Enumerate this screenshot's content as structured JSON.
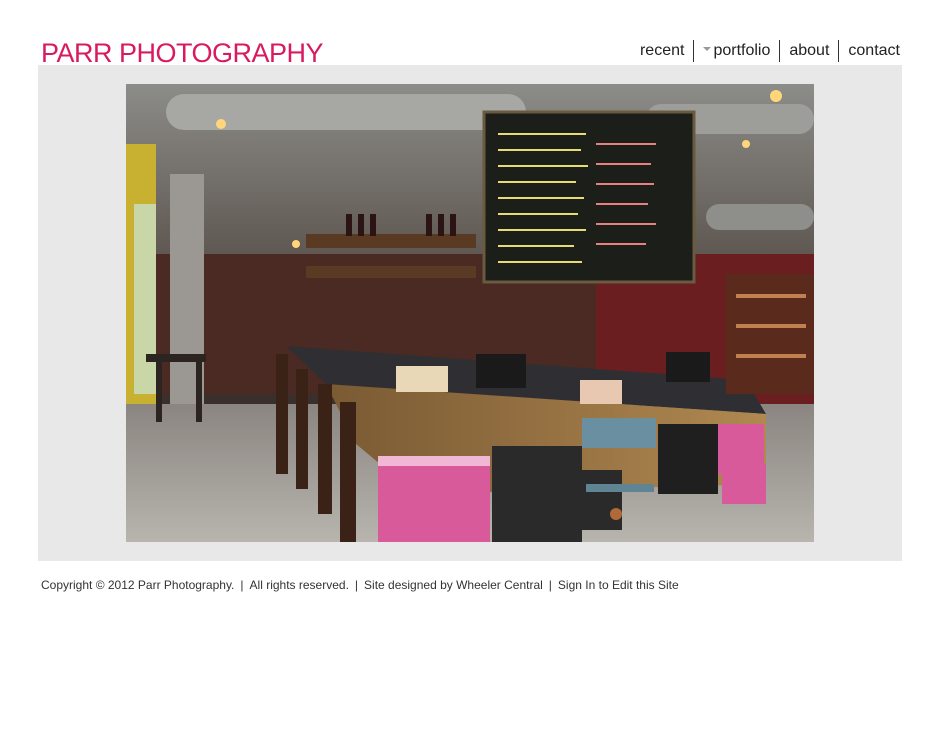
{
  "site": {
    "title": "PARR PHOTOGRAPHY"
  },
  "nav": {
    "items": [
      {
        "label": "recent"
      },
      {
        "label": "portfolio"
      },
      {
        "label": "about"
      },
      {
        "label": "contact"
      }
    ]
  },
  "gallery": {
    "photo_icon": "restaurant-bar-photo"
  },
  "colors": {
    "brand": "#d81b60",
    "gallery_bg": "#e8e8e8"
  },
  "footer": {
    "copyright": "Copyright © 2012 Parr Photography.",
    "rights": "All rights reserved.",
    "designed_by": "Site designed by Wheeler Central",
    "sign_in": "Sign In to Edit this Site",
    "separator": "|"
  }
}
